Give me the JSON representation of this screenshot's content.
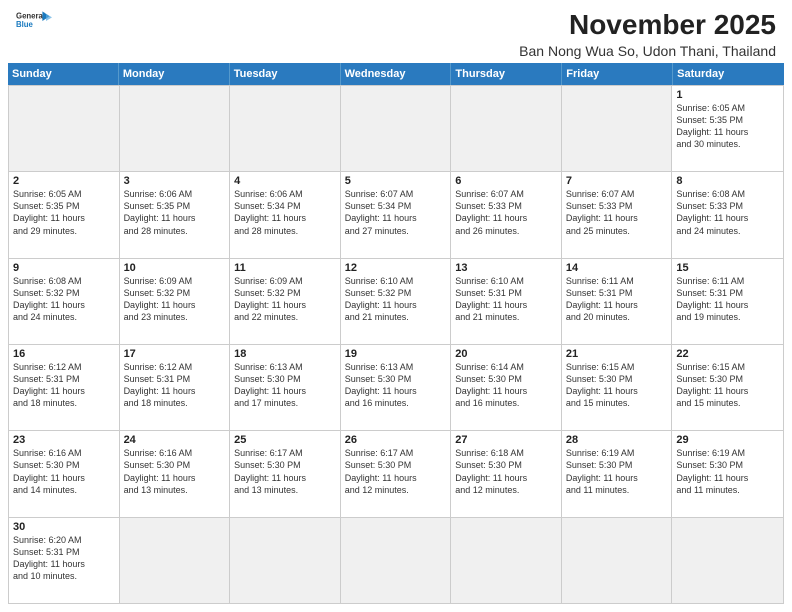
{
  "header": {
    "logo_general": "General",
    "logo_blue": "Blue",
    "title": "November 2025",
    "subtitle": "Ban Nong Wua So, Udon Thani, Thailand"
  },
  "calendar": {
    "days_of_week": [
      "Sunday",
      "Monday",
      "Tuesday",
      "Wednesday",
      "Thursday",
      "Friday",
      "Saturday"
    ],
    "weeks": [
      [
        {
          "day": "",
          "info": "",
          "empty": true
        },
        {
          "day": "",
          "info": "",
          "empty": true
        },
        {
          "day": "",
          "info": "",
          "empty": true
        },
        {
          "day": "",
          "info": "",
          "empty": true
        },
        {
          "day": "",
          "info": "",
          "empty": true
        },
        {
          "day": "",
          "info": "",
          "empty": true
        },
        {
          "day": "1",
          "info": "Sunrise: 6:05 AM\nSunset: 5:35 PM\nDaylight: 11 hours\nand 30 minutes.",
          "empty": false
        }
      ],
      [
        {
          "day": "2",
          "info": "Sunrise: 6:05 AM\nSunset: 5:35 PM\nDaylight: 11 hours\nand 29 minutes.",
          "empty": false
        },
        {
          "day": "3",
          "info": "Sunrise: 6:06 AM\nSunset: 5:35 PM\nDaylight: 11 hours\nand 28 minutes.",
          "empty": false
        },
        {
          "day": "4",
          "info": "Sunrise: 6:06 AM\nSunset: 5:34 PM\nDaylight: 11 hours\nand 28 minutes.",
          "empty": false
        },
        {
          "day": "5",
          "info": "Sunrise: 6:07 AM\nSunset: 5:34 PM\nDaylight: 11 hours\nand 27 minutes.",
          "empty": false
        },
        {
          "day": "6",
          "info": "Sunrise: 6:07 AM\nSunset: 5:33 PM\nDaylight: 11 hours\nand 26 minutes.",
          "empty": false
        },
        {
          "day": "7",
          "info": "Sunrise: 6:07 AM\nSunset: 5:33 PM\nDaylight: 11 hours\nand 25 minutes.",
          "empty": false
        },
        {
          "day": "8",
          "info": "Sunrise: 6:08 AM\nSunset: 5:33 PM\nDaylight: 11 hours\nand 24 minutes.",
          "empty": false
        }
      ],
      [
        {
          "day": "9",
          "info": "Sunrise: 6:08 AM\nSunset: 5:32 PM\nDaylight: 11 hours\nand 24 minutes.",
          "empty": false
        },
        {
          "day": "10",
          "info": "Sunrise: 6:09 AM\nSunset: 5:32 PM\nDaylight: 11 hours\nand 23 minutes.",
          "empty": false
        },
        {
          "day": "11",
          "info": "Sunrise: 6:09 AM\nSunset: 5:32 PM\nDaylight: 11 hours\nand 22 minutes.",
          "empty": false
        },
        {
          "day": "12",
          "info": "Sunrise: 6:10 AM\nSunset: 5:32 PM\nDaylight: 11 hours\nand 21 minutes.",
          "empty": false
        },
        {
          "day": "13",
          "info": "Sunrise: 6:10 AM\nSunset: 5:31 PM\nDaylight: 11 hours\nand 21 minutes.",
          "empty": false
        },
        {
          "day": "14",
          "info": "Sunrise: 6:11 AM\nSunset: 5:31 PM\nDaylight: 11 hours\nand 20 minutes.",
          "empty": false
        },
        {
          "day": "15",
          "info": "Sunrise: 6:11 AM\nSunset: 5:31 PM\nDaylight: 11 hours\nand 19 minutes.",
          "empty": false
        }
      ],
      [
        {
          "day": "16",
          "info": "Sunrise: 6:12 AM\nSunset: 5:31 PM\nDaylight: 11 hours\nand 18 minutes.",
          "empty": false
        },
        {
          "day": "17",
          "info": "Sunrise: 6:12 AM\nSunset: 5:31 PM\nDaylight: 11 hours\nand 18 minutes.",
          "empty": false
        },
        {
          "day": "18",
          "info": "Sunrise: 6:13 AM\nSunset: 5:30 PM\nDaylight: 11 hours\nand 17 minutes.",
          "empty": false
        },
        {
          "day": "19",
          "info": "Sunrise: 6:13 AM\nSunset: 5:30 PM\nDaylight: 11 hours\nand 16 minutes.",
          "empty": false
        },
        {
          "day": "20",
          "info": "Sunrise: 6:14 AM\nSunset: 5:30 PM\nDaylight: 11 hours\nand 16 minutes.",
          "empty": false
        },
        {
          "day": "21",
          "info": "Sunrise: 6:15 AM\nSunset: 5:30 PM\nDaylight: 11 hours\nand 15 minutes.",
          "empty": false
        },
        {
          "day": "22",
          "info": "Sunrise: 6:15 AM\nSunset: 5:30 PM\nDaylight: 11 hours\nand 15 minutes.",
          "empty": false
        }
      ],
      [
        {
          "day": "23",
          "info": "Sunrise: 6:16 AM\nSunset: 5:30 PM\nDaylight: 11 hours\nand 14 minutes.",
          "empty": false
        },
        {
          "day": "24",
          "info": "Sunrise: 6:16 AM\nSunset: 5:30 PM\nDaylight: 11 hours\nand 13 minutes.",
          "empty": false
        },
        {
          "day": "25",
          "info": "Sunrise: 6:17 AM\nSunset: 5:30 PM\nDaylight: 11 hours\nand 13 minutes.",
          "empty": false
        },
        {
          "day": "26",
          "info": "Sunrise: 6:17 AM\nSunset: 5:30 PM\nDaylight: 11 hours\nand 12 minutes.",
          "empty": false
        },
        {
          "day": "27",
          "info": "Sunrise: 6:18 AM\nSunset: 5:30 PM\nDaylight: 11 hours\nand 12 minutes.",
          "empty": false
        },
        {
          "day": "28",
          "info": "Sunrise: 6:19 AM\nSunset: 5:30 PM\nDaylight: 11 hours\nand 11 minutes.",
          "empty": false
        },
        {
          "day": "29",
          "info": "Sunrise: 6:19 AM\nSunset: 5:30 PM\nDaylight: 11 hours\nand 11 minutes.",
          "empty": false
        }
      ],
      [
        {
          "day": "30",
          "info": "Sunrise: 6:20 AM\nSunset: 5:31 PM\nDaylight: 11 hours\nand 10 minutes.",
          "empty": false
        },
        {
          "day": "",
          "info": "",
          "empty": true
        },
        {
          "day": "",
          "info": "",
          "empty": true
        },
        {
          "day": "",
          "info": "",
          "empty": true
        },
        {
          "day": "",
          "info": "",
          "empty": true
        },
        {
          "day": "",
          "info": "",
          "empty": true
        },
        {
          "day": "",
          "info": "",
          "empty": true
        }
      ]
    ]
  }
}
